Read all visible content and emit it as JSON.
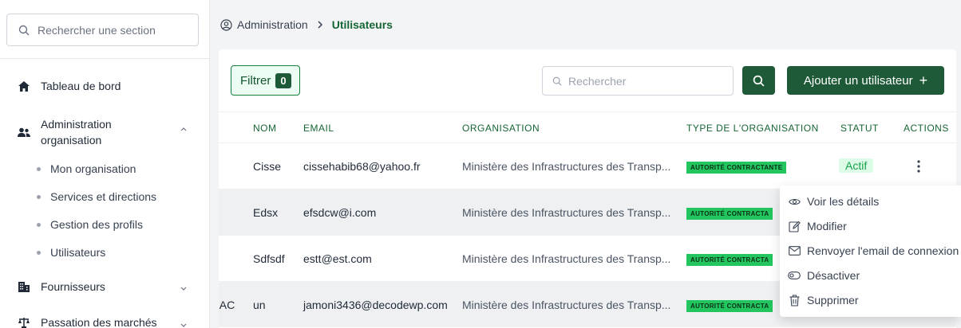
{
  "sidebar": {
    "search_placeholder": "Rechercher une section",
    "items": {
      "dashboard": "Tableau de bord",
      "admin_org_line1": "Administration",
      "admin_org_line2": "organisation",
      "suppliers": "Fournisseurs",
      "procurement": "Passation des marchés"
    },
    "subitems": [
      "Mon organisation",
      "Services et directions",
      "Gestion des profils",
      "Utilisateurs"
    ]
  },
  "breadcrumb": {
    "parent": "Administration",
    "current": "Utilisateurs"
  },
  "toolbar": {
    "filter_label": "Filtrer",
    "filter_count": "0",
    "search_placeholder": "Rechercher",
    "add_label": "Ajouter un utilisateur"
  },
  "table": {
    "headers": {
      "nom": "NOM",
      "email": "EMAIL",
      "organisation": "ORGANISATION",
      "type": "TYPE DE L'ORGANISATION",
      "statut": "STATUT",
      "actions": "ACTIONS"
    },
    "rows": [
      {
        "prefix": "",
        "nom": "Cisse",
        "email": "cissehabib68@yahoo.fr",
        "organisation": "Ministère des Infrastructures des Transp...",
        "type": "AUTORITÉ CONTRACTANTE",
        "statut": "Actif"
      },
      {
        "prefix": "",
        "nom": "Edsx",
        "email": "efsdcw@i.com",
        "organisation": "Ministère des Infrastructures des Transp...",
        "type": "AUTORITÉ CONTRACTA",
        "statut": ""
      },
      {
        "prefix": "",
        "nom": "Sdfsdf",
        "email": "estt@est.com",
        "organisation": "Ministère des Infrastructures des Transp...",
        "type": "AUTORITÉ CONTRACTA",
        "statut": ""
      },
      {
        "prefix": "r AC",
        "nom": "un",
        "email": "jamoni3436@decodewp.com",
        "organisation": "Ministère des Infrastructures des Transp...",
        "type": "AUTORITÉ CONTRACTA",
        "statut": ""
      }
    ]
  },
  "menu": {
    "view": "Voir les détails",
    "edit": "Modifier",
    "resend": "Renvoyer l'email de connexion",
    "deactivate": "Désactiver",
    "delete": "Supprimer"
  },
  "colors": {
    "primary": "#1e5a37",
    "accent_text": "#166534",
    "badge": "#22c55e"
  }
}
